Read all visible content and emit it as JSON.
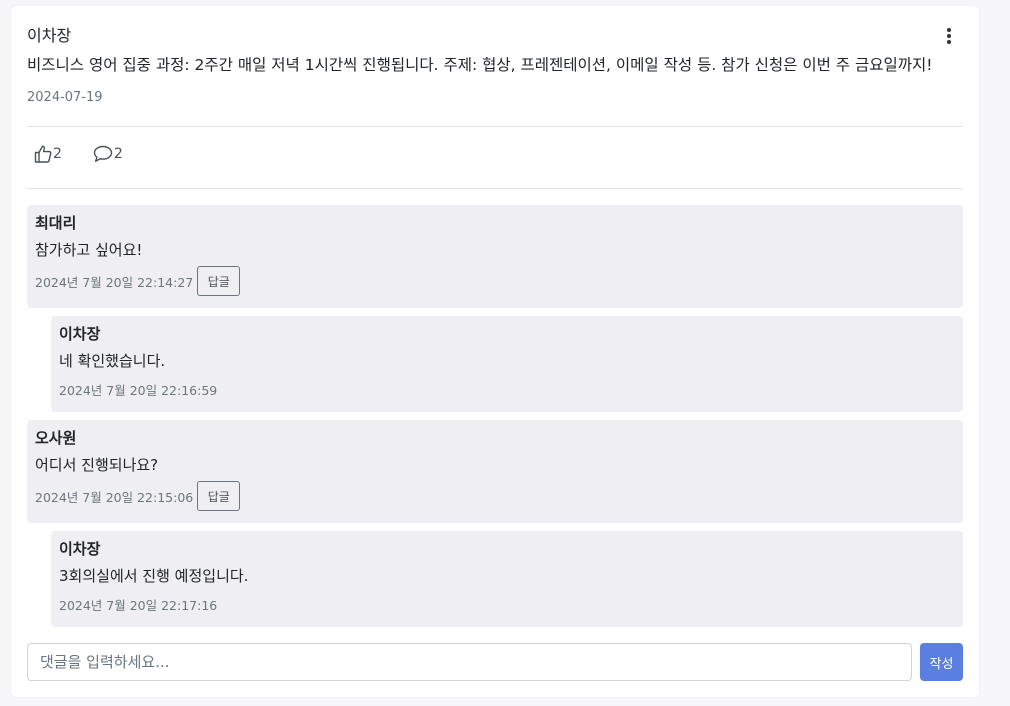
{
  "post": {
    "author": "이차장",
    "content": "비즈니스 영어 집중 과정: 2주간 매일 저녁 1시간씩 진행됩니다. 주제: 협상, 프레젠테이션, 이메일 작성 등. 참가 신청은 이번 주 금요일까지!",
    "date": "2024-07-19",
    "like_count": "2",
    "comment_count": "2"
  },
  "comments": [
    {
      "author": "최대리",
      "text": "참가하고 싶어요!",
      "time": "2024년 7월 20일 22:14:27",
      "reply_label": "답글",
      "replies": [
        {
          "author": "이차장",
          "text": "네 확인했습니다.",
          "time": "2024년 7월 20일 22:16:59"
        }
      ]
    },
    {
      "author": "오사원",
      "text": "어디서 진행되나요?",
      "time": "2024년 7월 20일 22:15:06",
      "reply_label": "답글",
      "replies": [
        {
          "author": "이차장",
          "text": "3회의실에서 진행 예정입니다.",
          "time": "2024년 7월 20일 22:17:16"
        }
      ]
    }
  ],
  "comment_form": {
    "placeholder": "댓글을 입력하세요...",
    "value": "",
    "submit_label": "작성"
  },
  "icons": {
    "more": "more-vertical-icon",
    "like": "thumbs-up-icon",
    "comment": "speech-bubble-icon"
  },
  "colors": {
    "accent": "#5b7fe0",
    "comment_bg": "#efeff3"
  }
}
